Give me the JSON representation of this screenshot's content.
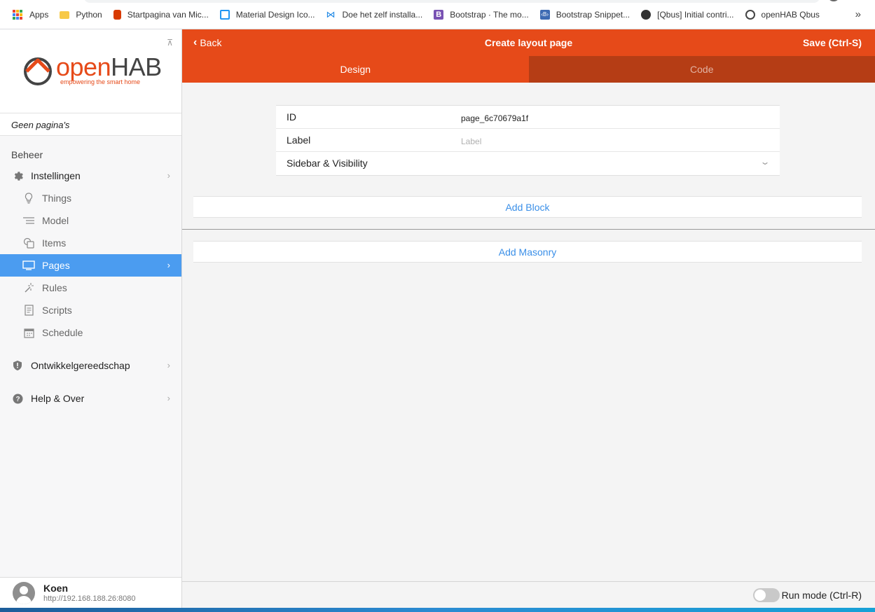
{
  "bookmarks": [
    {
      "label": "Apps",
      "icon": "apps-grid-icon",
      "color": "#4285f4"
    },
    {
      "label": "Python",
      "icon": "folder-icon",
      "color": "#f7c948"
    },
    {
      "label": "Startpagina van Mic...",
      "icon": "office-icon",
      "color": "#d83b01"
    },
    {
      "label": "Material Design Ico...",
      "icon": "material-icon",
      "color": "#2196f3"
    },
    {
      "label": "Doe het zelf installa...",
      "icon": "bow-icon",
      "color": "#1e88e5"
    },
    {
      "label": "Bootstrap · The mo...",
      "icon": "bootstrap-icon",
      "color": "#7952b3"
    },
    {
      "label": "Bootstrap Snippet...",
      "icon": "snippet-icon",
      "color": "#3d6bb3"
    },
    {
      "label": "[Qbus] Initial contri...",
      "icon": "github-icon",
      "color": "#333333"
    },
    {
      "label": "openHAB Qbus",
      "icon": "openhab-icon",
      "color": "#e64a19"
    }
  ],
  "bookmarks_more": "»",
  "sidebar": {
    "logo_text_a": "open",
    "logo_text_b": "HAB",
    "logo_tagline": "empowering the smart home",
    "no_pages": "Geen pagina's",
    "section_title": "Beheer",
    "settings": {
      "label": "Instellingen",
      "icon": "gear-icon"
    },
    "sub_items": [
      {
        "label": "Things",
        "icon": "lightbulb-icon"
      },
      {
        "label": "Model",
        "icon": "list-icon"
      },
      {
        "label": "Items",
        "icon": "items-icon"
      },
      {
        "label": "Pages",
        "icon": "monitor-icon"
      },
      {
        "label": "Rules",
        "icon": "wand-icon"
      },
      {
        "label": "Scripts",
        "icon": "script-icon"
      },
      {
        "label": "Schedule",
        "icon": "calendar-icon"
      }
    ],
    "developer": {
      "label": "Ontwikkelgereedschap",
      "icon": "shield-icon"
    },
    "help": {
      "label": "Help & Over",
      "icon": "help-icon"
    },
    "user": {
      "name": "Koen",
      "url": "http://192.168.188.26:8080"
    }
  },
  "navbar": {
    "back_label": "Back",
    "title": "Create layout page",
    "save_label": "Save (Ctrl-S)"
  },
  "tabs": [
    {
      "label": "Design",
      "active": true
    },
    {
      "label": "Code",
      "active": false
    }
  ],
  "form": {
    "id_label": "ID",
    "id_value": "page_6c70679a1f",
    "label_label": "Label",
    "label_placeholder": "Label",
    "visibility_label": "Sidebar & Visibility"
  },
  "add_block_label": "Add Block",
  "add_masonry_label": "Add Masonry",
  "run_mode_label": "Run mode (Ctrl-R)",
  "colors": {
    "accent": "#e64a19",
    "accent_dark": "#b53d15",
    "active_nav": "#4b9cf0",
    "link": "#3a8fe8"
  }
}
